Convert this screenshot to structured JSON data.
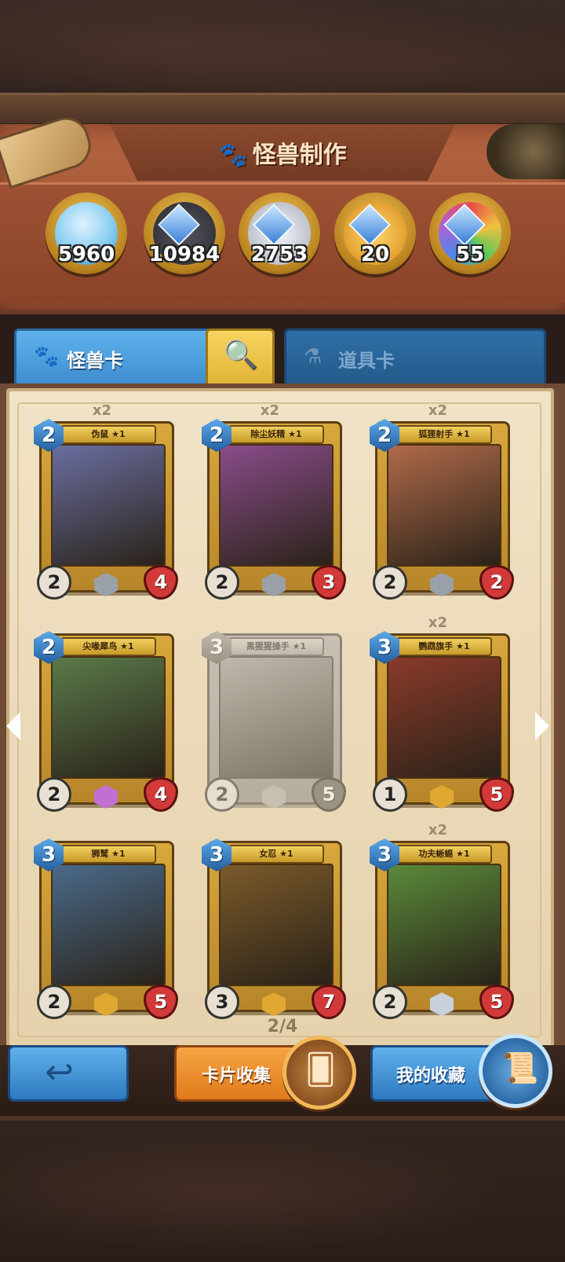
{
  "header": {
    "title": "怪兽制作",
    "paw_icon": "paw-icon"
  },
  "resources": [
    {
      "name": "dust-bottle",
      "value": "5960",
      "color": "#7fc8f0"
    },
    {
      "name": "black-gem",
      "value": "10984",
      "color": "#3a3a44"
    },
    {
      "name": "silver-gem",
      "value": "2753",
      "color": "#c9ccd4"
    },
    {
      "name": "gold-gem",
      "value": "20",
      "color": "#e9a630"
    },
    {
      "name": "rainbow-gem",
      "value": "55",
      "color": "#b35fd6"
    }
  ],
  "tabs": {
    "monster_label": "怪兽卡",
    "item_label": "道具卡"
  },
  "cards": [
    {
      "count": "x2",
      "name": "伪鼠 ★1",
      "cost": "2",
      "atk": "2",
      "hp": "4",
      "art": "#6a6ea0",
      "rarity": "#9aa0a8",
      "locked": false
    },
    {
      "count": "x2",
      "name": "除尘妖精 ★1",
      "cost": "2",
      "atk": "2",
      "hp": "3",
      "art": "#8a4c8a",
      "rarity": "#9aa0a8",
      "locked": false
    },
    {
      "count": "x2",
      "name": "狐狸射手 ★1",
      "cost": "2",
      "atk": "2",
      "hp": "2",
      "art": "#b06a4a",
      "rarity": "#9aa0a8",
      "locked": false
    },
    {
      "count": "",
      "name": "尖喙犀鸟 ★1",
      "cost": "2",
      "atk": "2",
      "hp": "4",
      "art": "#5a7a4a",
      "rarity": "#c070d0",
      "locked": false
    },
    {
      "count": "",
      "name": "黑猩猩操手 ★1",
      "cost": "3",
      "atk": "2",
      "hp": "5",
      "art": "#9a9a9a",
      "rarity": "#e0a830",
      "locked": true
    },
    {
      "count": "x2",
      "name": "鹦鹉旗手 ★1",
      "cost": "3",
      "atk": "1",
      "hp": "5",
      "art": "#8a3a2a",
      "rarity": "#e0a830",
      "locked": false
    },
    {
      "count": "",
      "name": "狮鹫 ★1",
      "cost": "3",
      "atk": "2",
      "hp": "5",
      "art": "#4a6a8a",
      "rarity": "#e0a830",
      "locked": false
    },
    {
      "count": "",
      "name": "女忍 ★1",
      "cost": "3",
      "atk": "3",
      "hp": "7",
      "art": "#7a5a2a",
      "rarity": "#e0a830",
      "locked": false
    },
    {
      "count": "x2",
      "name": "功夫蜥蜴 ★1",
      "cost": "3",
      "atk": "2",
      "hp": "5",
      "art": "#5a8a3a",
      "rarity": "#c8d0dc",
      "locked": false
    }
  ],
  "pager": "2/4",
  "buttons": {
    "collect_label": "卡片收集",
    "favorites_label": "我的收藏"
  }
}
